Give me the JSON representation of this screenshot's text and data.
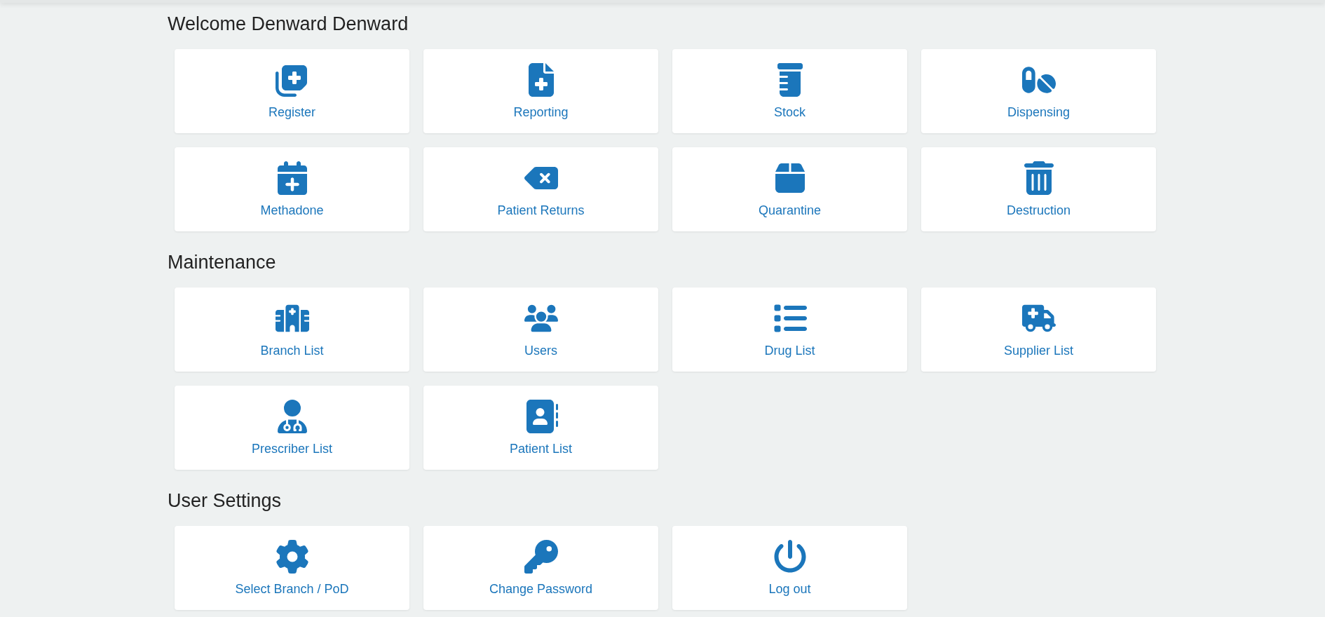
{
  "sections": [
    {
      "title": "Welcome Denward Denward",
      "items": [
        {
          "label": "Register"
        },
        {
          "label": "Reporting"
        },
        {
          "label": "Stock"
        },
        {
          "label": "Dispensing"
        },
        {
          "label": "Methadone"
        },
        {
          "label": "Patient Returns"
        },
        {
          "label": "Quarantine"
        },
        {
          "label": "Destruction"
        }
      ]
    },
    {
      "title": "Maintenance",
      "items": [
        {
          "label": "Branch List"
        },
        {
          "label": "Users"
        },
        {
          "label": "Drug List"
        },
        {
          "label": "Supplier List"
        },
        {
          "label": "Prescriber List"
        },
        {
          "label": "Patient List"
        }
      ]
    },
    {
      "title": "User Settings",
      "items": [
        {
          "label": "Select Branch / PoD"
        },
        {
          "label": "Change Password"
        },
        {
          "label": "Log out"
        }
      ]
    }
  ]
}
